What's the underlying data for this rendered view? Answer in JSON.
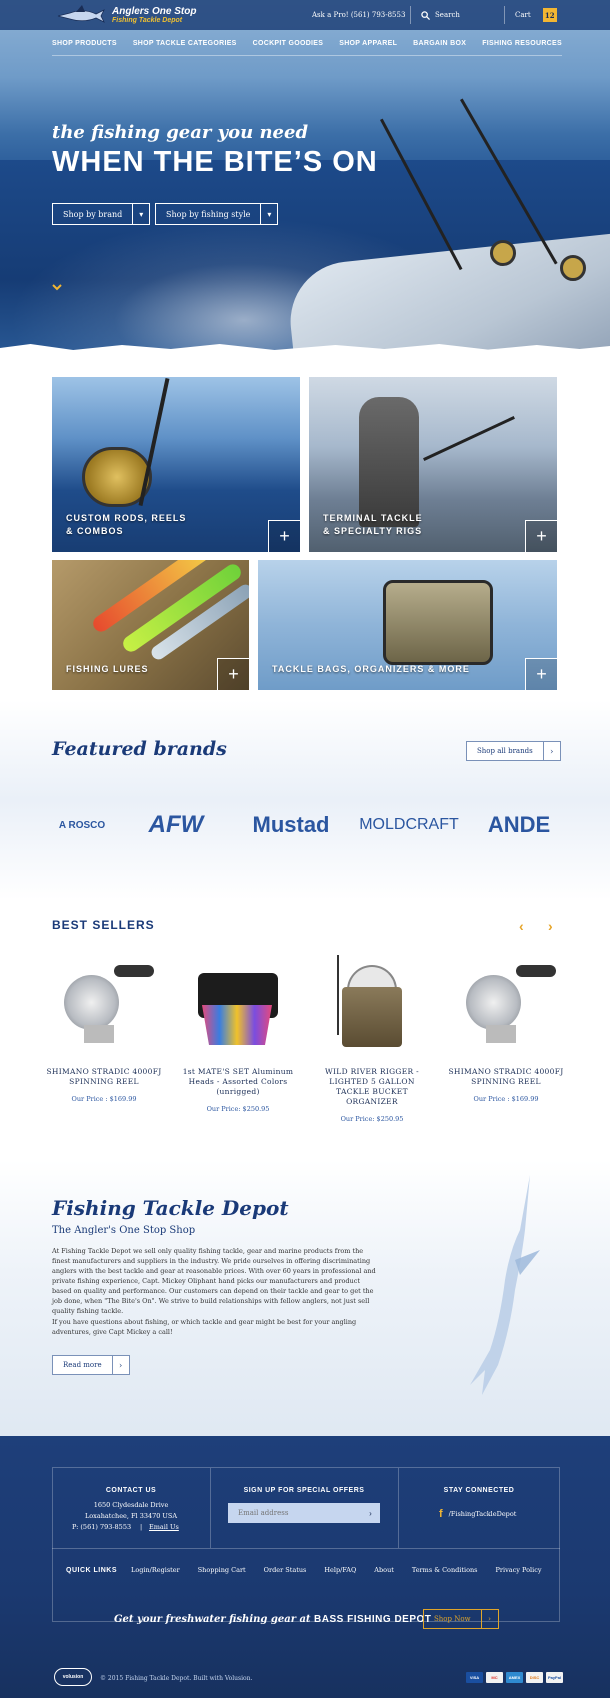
{
  "header": {
    "brand_line1": "Anglers One Stop",
    "brand_line2": "Fishing Tackle Depot",
    "ask_pro": "Ask a Pro!  (561) 793-8553",
    "search_label": "Search",
    "cart_label": "Cart",
    "cart_count": "12"
  },
  "nav": [
    "SHOP PRODUCTS",
    "SHOP TACKLE CATEGORIES",
    "COCKPIT GOODIES",
    "SHOP APPAREL",
    "BARGAIN BOX",
    "FISHING RESOURCES"
  ],
  "hero": {
    "tagline": "the fishing gear you need",
    "headline": "WHEN THE BITE’S ON",
    "select_brand": "Shop by brand",
    "select_style": "Shop by fishing style"
  },
  "categories": [
    {
      "line1": "CUSTOM RODS, REELS",
      "line2": "& COMBOS"
    },
    {
      "line1": "TERMINAL TACKLE",
      "line2": "& SPECIALTY RIGS"
    },
    {
      "line1": "FISHING LURES",
      "line2": ""
    },
    {
      "line1": "TACKLE BAGS, ORGANIZERS & MORE",
      "line2": ""
    }
  ],
  "featured": {
    "title": "Featured brands",
    "shop_all": "Shop all brands",
    "brands": [
      "A ROSCO",
      "AFW",
      "Mustad",
      "MOLDCRAFT",
      "ANDE"
    ]
  },
  "best_sellers": {
    "title": "BEST SELLERS",
    "products": [
      {
        "name": "SHIMANO STRADIC 4000FJ SPINNING REEL",
        "price": "Our Price : $169.99"
      },
      {
        "name": "1st MATE'S SET Aluminum Heads - Assorted Colors (unrigged)",
        "price": "Our Price: $250.95"
      },
      {
        "name": "WILD RIVER RIGGER - LIGHTED 5 GALLON TACKLE BUCKET ORGANIZER",
        "price": "Our Price: $250.95"
      },
      {
        "name": "SHIMANO STRADIC 4000FJ SPINNING REEL",
        "price": "Our Price : $169.99"
      }
    ]
  },
  "about": {
    "title": "Fishing Tackle Depot",
    "subtitle": "The Angler's One Stop Shop",
    "p1": "At Fishing Tackle Depot we sell only quality fishing tackle, gear and marine products from the finest manufacturers and suppliers in the industry. We pride ourselves in offering discriminating anglers with the best tackle and gear at reasonable prices. With over 60 years in professional and private fishing experience, Capt. Mickey Oliphant hand picks our manufacturers and product based on quality and performance. Our customers can depend on their tackle and gear to get the job done, when \"The Bite's On\". We strive to build relationships with fellow anglers, not just sell quality fishing tackle.",
    "p2": "If you have questions about fishing, or which tackle and gear might be best for your angling adventures, give Capt Mickey a call!",
    "read_more": "Read more"
  },
  "footer": {
    "contact_title": "CONTACT US",
    "address1": "1650 Clydesdale Drive",
    "address2": "Loxahatchee, Fl 33470 USA",
    "phone": "P: (561) 793-8553",
    "email_us": "Email Us",
    "signup_title": "SIGN UP FOR SPECIAL OFFERS",
    "email_placeholder": "Email address",
    "stay_title": "STAY CONNECTED",
    "facebook": "/FishingTackleDepot",
    "quick_links_label": "QUICK LINKS",
    "quick_links": [
      "Login/Register",
      "Shopping Cart",
      "Order Status",
      "Help/FAQ",
      "About",
      "Terms & Conditions",
      "Privacy Policy"
    ],
    "bass_text": "Get your freshwater fishing gear at",
    "bass_brand": "BASS FISHING DEPOT",
    "shop_now": "Shop Now",
    "copyright": "© 2015 Fishing Tackle Depot. Built with Volusion.",
    "volusion": "volusion",
    "cards": [
      "VISA",
      "MC",
      "AMEX",
      "DISC",
      "PayPal"
    ]
  },
  "colors": {
    "navy": "#1a3a78",
    "gold": "#f2b632",
    "footer": "#1e3f7a"
  }
}
